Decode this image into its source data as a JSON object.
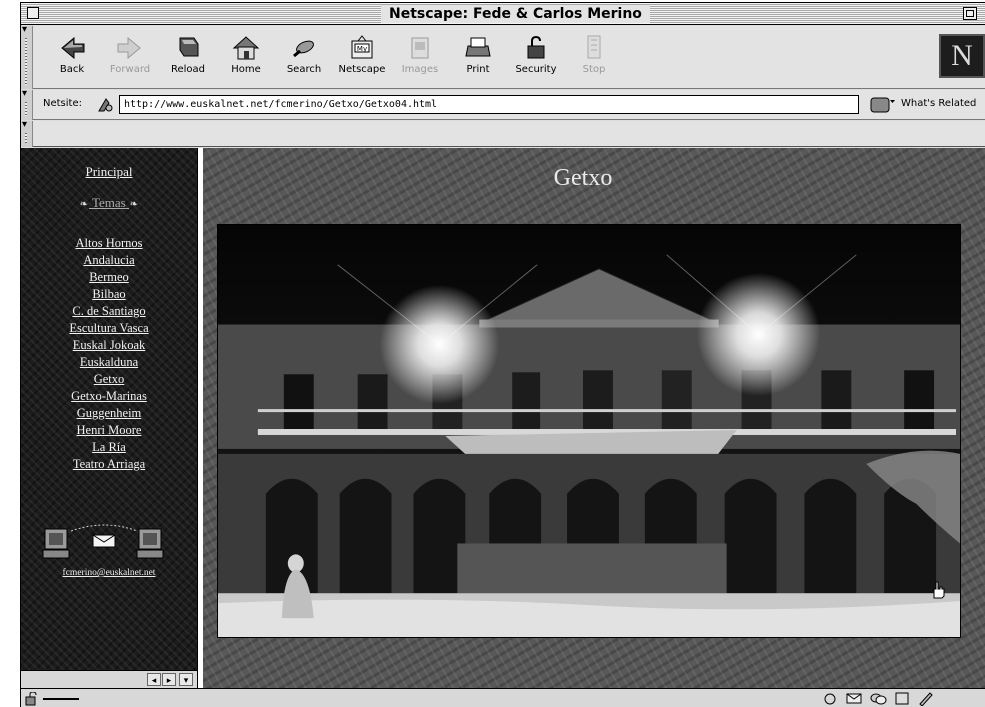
{
  "window": {
    "title": "Netscape: Fede & Carlos Merino"
  },
  "toolbar": {
    "buttons": [
      {
        "label": "Back",
        "icon": "back-arrow-icon",
        "enabled": true
      },
      {
        "label": "Forward",
        "icon": "forward-arrow-icon",
        "enabled": false
      },
      {
        "label": "Reload",
        "icon": "reload-icon",
        "enabled": true
      },
      {
        "label": "Home",
        "icon": "home-icon",
        "enabled": true
      },
      {
        "label": "Search",
        "icon": "search-icon",
        "enabled": true
      },
      {
        "label": "Netscape",
        "icon": "netscape-icon",
        "enabled": true
      },
      {
        "label": "Images",
        "icon": "images-icon",
        "enabled": false
      },
      {
        "label": "Print",
        "icon": "print-icon",
        "enabled": true
      },
      {
        "label": "Security",
        "icon": "security-lock-icon",
        "enabled": true
      },
      {
        "label": "Stop",
        "icon": "stop-icon",
        "enabled": false
      }
    ],
    "logo_letter": "N"
  },
  "location": {
    "label": "Netsite:",
    "url": "http://www.euskalnet.net/fcmerino/Getxo/Getxo04.html",
    "related_label": "What's Related"
  },
  "nav": {
    "principal": "Principal",
    "temas": "Temas",
    "items": [
      "Altos Hornos",
      "Andalucia",
      "Bermeo",
      "Bilbao",
      "C. de Santiago",
      "Escultura Vasca",
      "Euskal Jokoak",
      "Euskalduna",
      "Getxo",
      "Getxo-Marinas",
      "Guggenheim",
      "Henri Moore",
      "La Ría",
      "Teatro Arriaga"
    ],
    "email": "fcmerino@euskalnet.net"
  },
  "main": {
    "heading": "Getxo",
    "photo_icon": "night-building-photo"
  },
  "colors": {
    "window_chrome": "#dddddd",
    "left_frame_bg": "#1c1c1c",
    "right_frame_bg": "#585858",
    "link_text": "#f2f2f2"
  }
}
